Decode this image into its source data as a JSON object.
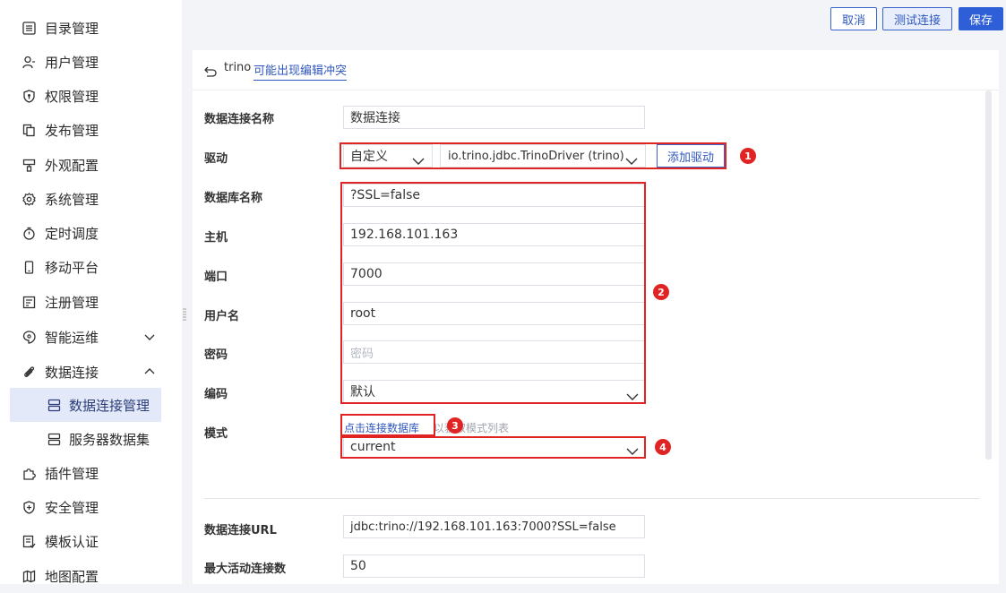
{
  "sidebar": {
    "items": [
      {
        "label": "目录管理",
        "icon": "list-icon"
      },
      {
        "label": "用户管理",
        "icon": "user-icon"
      },
      {
        "label": "权限管理",
        "icon": "shield-icon"
      },
      {
        "label": "发布管理",
        "icon": "publish-icon"
      },
      {
        "label": "外观配置",
        "icon": "appearance-icon"
      },
      {
        "label": "系统管理",
        "icon": "gear-icon"
      },
      {
        "label": "定时调度",
        "icon": "timer-icon"
      },
      {
        "label": "移动平台",
        "icon": "mobile-icon"
      },
      {
        "label": "注册管理",
        "icon": "register-icon"
      },
      {
        "label": "智能运维",
        "icon": "ops-icon"
      },
      {
        "label": "数据连接",
        "icon": "paperclip-icon"
      },
      {
        "label": "数据连接管理",
        "icon": "database-icon"
      },
      {
        "label": "服务器数据集",
        "icon": "dataset-icon"
      },
      {
        "label": "插件管理",
        "icon": "plugin-icon"
      },
      {
        "label": "安全管理",
        "icon": "security-icon"
      },
      {
        "label": "模板认证",
        "icon": "template-icon"
      },
      {
        "label": "地图配置",
        "icon": "map-icon"
      }
    ]
  },
  "toolbar": {
    "cancel_label": "取消",
    "test_label": "测试连接",
    "save_label": "保存"
  },
  "header": {
    "connection_name": "trino",
    "conflict_link": "可能出现编辑冲突"
  },
  "form": {
    "name_label": "数据连接名称",
    "name_value": "数据连接",
    "driver_label": "驱动",
    "driver_type": "自定义",
    "driver_class": "io.trino.jdbc.TrinoDriver (trino)",
    "add_driver": "添加驱动",
    "db_label": "数据库名称",
    "db_value": "?SSL=false",
    "host_label": "主机",
    "host_value": "192.168.101.163",
    "port_label": "端口",
    "port_value": "7000",
    "user_label": "用户名",
    "user_value": "root",
    "password_label": "密码",
    "password_placeholder": "密码",
    "encoding_label": "编码",
    "encoding_value": "默认",
    "mode_label": "模式",
    "mode_link": "点击连接数据库",
    "mode_hint": "以获取模式列表",
    "mode_value": "current",
    "url_label": "数据连接URL",
    "url_value": "jdbc:trino://192.168.101.163:7000?SSL=false",
    "max_conn_label": "最大活动连接数",
    "max_conn_value": "50"
  },
  "annotations": {
    "b1": "1",
    "b2": "2",
    "b3": "3",
    "b4": "4"
  },
  "colors": {
    "accent": "#2f5fd7",
    "annotation_red": "#e02424"
  }
}
